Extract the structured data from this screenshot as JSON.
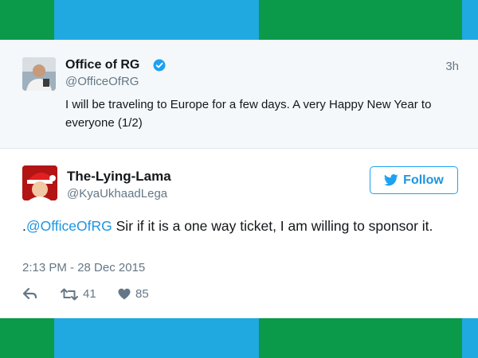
{
  "colors": {
    "green": "#0a9a4a",
    "blue": "#1fa9e0",
    "twitter_blue": "#1da1f2",
    "muted": "#657786",
    "text": "#14171a"
  },
  "quoted_tweet": {
    "name": "Office of RG",
    "handle": "@OfficeOfRG",
    "time": "3h",
    "text": "I will be traveling to Europe for a few days. A very Happy New Year to everyone (1/2)",
    "verified_icon": "verified-badge-icon"
  },
  "reply_tweet": {
    "name": "The-Lying-Lama",
    "handle": "@KyaUkhaadLega",
    "follow_label": "Follow",
    "text_prefix": ".",
    "mention": "@OfficeOfRG",
    "text_rest": " Sir if it is a one way ticket, I am willing to sponsor it.",
    "date": "2:13 PM - 28 Dec 2015",
    "retweets": "41",
    "likes": "85"
  }
}
